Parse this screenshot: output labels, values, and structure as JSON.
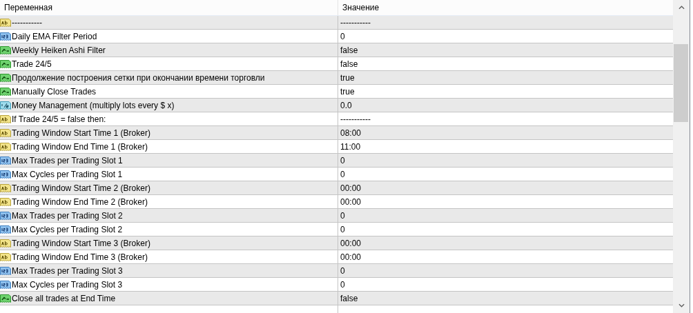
{
  "table": {
    "columns": [
      "Переменная",
      "Значение"
    ],
    "rows": [
      {
        "kind": "string",
        "name": "-----------",
        "value": "-----------"
      },
      {
        "kind": "int",
        "name": "Daily EMA Filter Period",
        "value": "0"
      },
      {
        "kind": "bool",
        "name": "Weekly Heiken Ashi Filter",
        "value": "false"
      },
      {
        "kind": "bool",
        "name": "Trade 24/5",
        "value": "false"
      },
      {
        "kind": "bool",
        "name": "Продолжение построения сетки при окончании времени торговли",
        "value": "true"
      },
      {
        "kind": "bool",
        "name": "Manually Close Trades",
        "value": "true"
      },
      {
        "kind": "double",
        "name": "Money Management (multiply lots every $ x)",
        "value": "0.0"
      },
      {
        "kind": "string",
        "name": "If Trade 24/5 = false then:",
        "value": "-----------"
      },
      {
        "kind": "string",
        "name": "Trading Window Start Time 1 (Broker)",
        "value": "08:00"
      },
      {
        "kind": "string",
        "name": "Trading Window End Time 1 (Broker)",
        "value": "11:00"
      },
      {
        "kind": "int",
        "name": "Max Trades per Trading Slot 1",
        "value": "0"
      },
      {
        "kind": "int",
        "name": "Max Cycles per Trading Slot 1",
        "value": "0"
      },
      {
        "kind": "string",
        "name": "Trading Window Start Time 2 (Broker)",
        "value": "00:00"
      },
      {
        "kind": "string",
        "name": "Trading Window End Time 2 (Broker)",
        "value": "00:00"
      },
      {
        "kind": "int",
        "name": "Max Trades per Trading Slot 2",
        "value": "0"
      },
      {
        "kind": "int",
        "name": "Max Cycles per Trading Slot 2",
        "value": "0"
      },
      {
        "kind": "string",
        "name": "Trading Window Start Time 3 (Broker)",
        "value": "00:00"
      },
      {
        "kind": "string",
        "name": "Trading Window End Time 3 (Broker)",
        "value": "00:00"
      },
      {
        "kind": "int",
        "name": "Max Trades per Trading Slot 3",
        "value": "0"
      },
      {
        "kind": "int",
        "name": "Max Cycles per Trading Slot 3",
        "value": "0"
      },
      {
        "kind": "bool",
        "name": "Close all trades at End Time",
        "value": "false"
      }
    ]
  }
}
